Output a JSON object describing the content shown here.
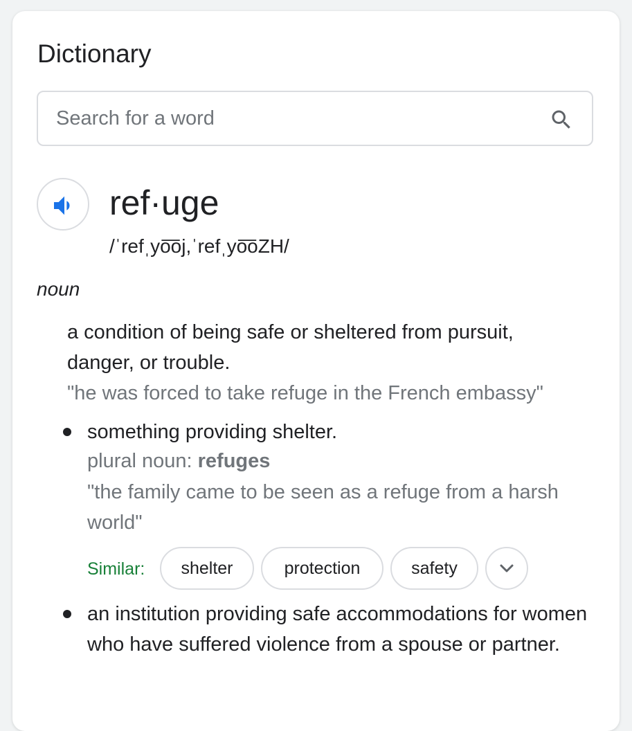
{
  "card": {
    "title": "Dictionary"
  },
  "search": {
    "placeholder": "Search for a word",
    "value": ""
  },
  "entry": {
    "word": "ref·uge",
    "phonetic": "/ˈrefˌyo͞oj,ˈrefˌyo͞oZH/",
    "part_of_speech": "noun",
    "definition": "a condition of being safe or sheltered from pursuit, danger, or trouble.",
    "example": "\"he was forced to take refuge in the French embassy\"",
    "senses": [
      {
        "text": "something providing shelter.",
        "grammar_label": "plural noun:",
        "grammar_value": "refuges",
        "example": "\"the family came to be seen as a refuge from a harsh world\""
      },
      {
        "text": "an institution providing safe accommodations for women who have suffered violence from a spouse or partner."
      }
    ],
    "similar": {
      "label": "Similar:",
      "words": [
        "shelter",
        "protection",
        "safety"
      ]
    }
  },
  "icons": {
    "search": "search-icon",
    "speaker": "speaker-icon",
    "expand": "chevron-down-icon"
  },
  "colors": {
    "accent_blue": "#1a73e8",
    "similar_green": "#188038",
    "secondary_text": "#70757a",
    "border": "#dadce0"
  }
}
